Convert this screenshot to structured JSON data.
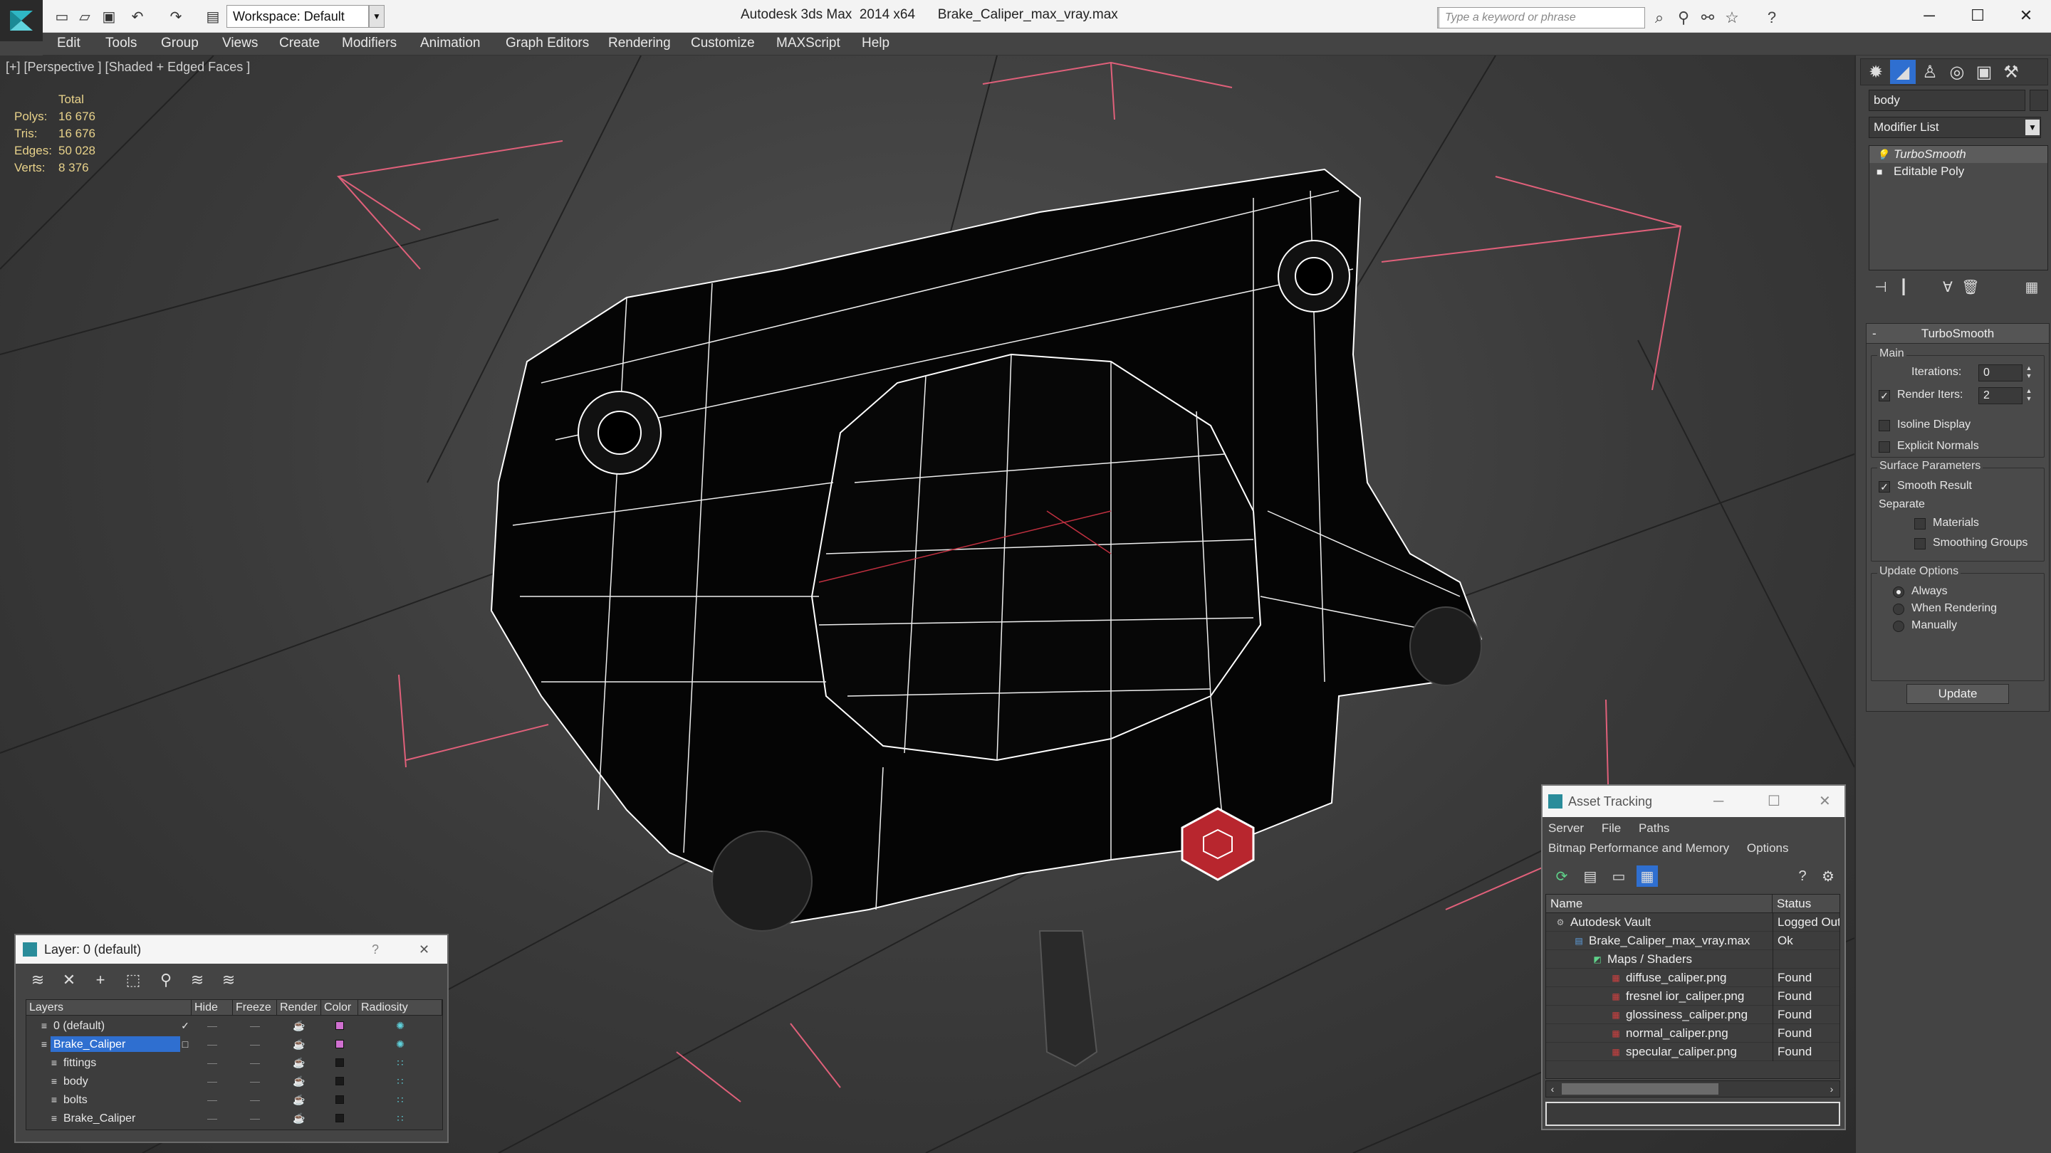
{
  "titlebar": {
    "app_title": "Autodesk 3ds Max  2014 x64",
    "file_name": "Brake_Caliper_max_vray.max",
    "workspace": "Workspace: Default",
    "search_placeholder": "Type a keyword or phrase"
  },
  "menu": [
    "Edit",
    "Tools",
    "Group",
    "Views",
    "Create",
    "Modifiers",
    "Animation",
    "Graph Editors",
    "Rendering",
    "Customize",
    "MAXScript",
    "Help"
  ],
  "viewport": {
    "label": "[+] [Perspective ] [Shaded + Edged Faces ]",
    "stats_header": "Total",
    "stats": [
      {
        "label": "Polys:",
        "value": "16 676"
      },
      {
        "label": "Tris:",
        "value": "16 676"
      },
      {
        "label": "Edges:",
        "value": "50 028"
      },
      {
        "label": "Verts:",
        "value": "8 376"
      }
    ]
  },
  "command_panel": {
    "object_name": "body",
    "modifier_list": "Modifier List",
    "stack": [
      {
        "label": "TurboSmooth",
        "selected": true
      },
      {
        "label": "Editable Poly",
        "selected": false
      }
    ],
    "turbosmooth": {
      "title": "TurboSmooth",
      "main_group": "Main",
      "iterations_label": "Iterations:",
      "iterations_value": "0",
      "render_iters_label": "Render Iters:",
      "render_iters_value": "2",
      "render_iters_checked": true,
      "isoline_label": "Isoline Display",
      "explicit_normals_label": "Explicit Normals",
      "surface_group": "Surface Parameters",
      "smooth_result_label": "Smooth Result",
      "separate_label": "Separate",
      "materials_label": "Materials",
      "smoothing_groups_label": "Smoothing Groups",
      "update_group": "Update Options",
      "always_label": "Always",
      "when_rendering_label": "When Rendering",
      "manually_label": "Manually",
      "update_button": "Update"
    }
  },
  "layer_dialog": {
    "title": "Layer: 0 (default)",
    "help": "?",
    "columns": [
      "Layers",
      "Hide",
      "Freeze",
      "Render",
      "Color",
      "Radiosity"
    ],
    "rows": [
      {
        "name": "0 (default)",
        "indent": 1,
        "color": "#d070d0",
        "selected": false
      },
      {
        "name": "Brake_Caliper",
        "indent": 1,
        "color": "#d070d0",
        "selected": true
      },
      {
        "name": "fittings",
        "indent": 2,
        "color": "#1a1a1a",
        "selected": false
      },
      {
        "name": "body",
        "indent": 2,
        "color": "#1a1a1a",
        "selected": false
      },
      {
        "name": "bolts",
        "indent": 2,
        "color": "#1a1a1a",
        "selected": false
      },
      {
        "name": "Brake_Caliper",
        "indent": 2,
        "color": "#1a1a1a",
        "selected": false
      }
    ]
  },
  "asset_dialog": {
    "title": "Asset Tracking",
    "menu1": [
      "Server",
      "File",
      "Paths"
    ],
    "menu2": [
      "Bitmap Performance and Memory",
      "Options"
    ],
    "columns": [
      "Name",
      "Status"
    ],
    "rows": [
      {
        "name": "Autodesk Vault",
        "status": "Logged Out",
        "indent": 0,
        "icon": "vault-icon"
      },
      {
        "name": "Brake_Caliper_max_vray.max",
        "status": "Ok",
        "indent": 1,
        "icon": "max-file-icon"
      },
      {
        "name": "Maps / Shaders",
        "status": "",
        "indent": 2,
        "icon": "maps-icon"
      },
      {
        "name": "diffuse_caliper.png",
        "status": "Found",
        "indent": 3,
        "icon": "png-icon"
      },
      {
        "name": "fresnel ior_caliper.png",
        "status": "Found",
        "indent": 3,
        "icon": "png-icon"
      },
      {
        "name": "glossiness_caliper.png",
        "status": "Found",
        "indent": 3,
        "icon": "png-icon"
      },
      {
        "name": "normal_caliper.png",
        "status": "Found",
        "indent": 3,
        "icon": "png-icon"
      },
      {
        "name": "specular_caliper.png",
        "status": "Found",
        "indent": 3,
        "icon": "png-icon"
      }
    ]
  },
  "colors": {
    "viewport_bg": "#3a3a3a",
    "stats_text": "#e8d28a",
    "selection_blue": "#2f6fd0",
    "wire_red": "#d04050"
  }
}
